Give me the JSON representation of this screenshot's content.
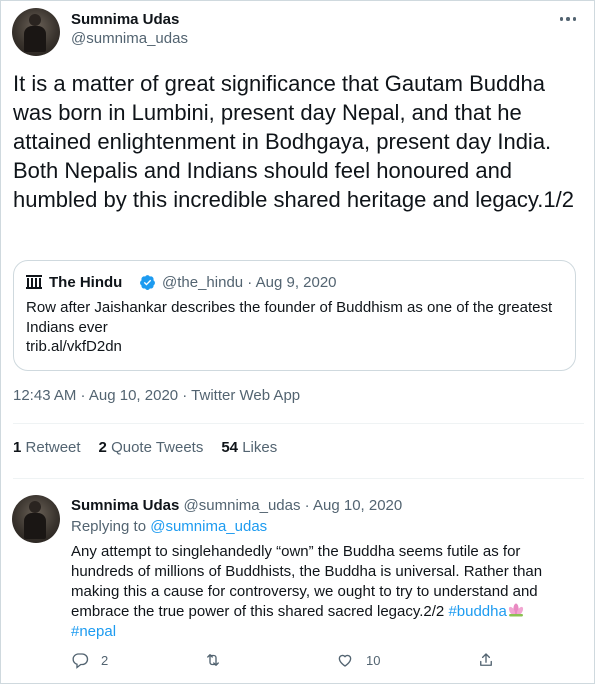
{
  "tweet": {
    "author_name": "Sumnima Udas",
    "author_handle": "@sumnima_udas",
    "text": "It is a matter of great significance that Gautam Buddha was born in Lumbini, present day Nepal, and that he attained enlightenment in Bodhgaya, present day India. Both Nepalis and Indians should feel honoured and humbled by this incredible shared heritage and legacy.1/2",
    "timestamp": "12:43 AM · Aug 10, 2020 · Twitter Web App",
    "icons": {
      "more": "more-icon"
    }
  },
  "quote": {
    "name": "The Hindu",
    "handle_date": "@the_hindu · Aug 9, 2020",
    "text": "Row after Jaishankar describes the founder of Buddhism as one of the greatest Indians ever",
    "link": "trib.al/vkfD2dn",
    "icons": {
      "logo": "the-hindu-icon",
      "verified": "verified-icon"
    }
  },
  "stats": {
    "retweets_count": "1",
    "retweets_label": "Retweet",
    "quotes_count": "2",
    "quotes_label": "Quote Tweets",
    "likes_count": "54",
    "likes_label": "Likes"
  },
  "reply": {
    "author_name": "Sumnima Udas",
    "meta": "@sumnima_udas · Aug 10, 2020",
    "replying_prefix": "Replying to",
    "replying_mention": "@sumnima_udas",
    "text": "Any attempt to singlehandedly “own” the Buddha seems futile as for hundreds of millions of Buddhists, the Buddha is universal. Rather than making this a cause for controversy, we ought to try to understand and embrace the true power of this shared sacred legacy.2/2",
    "hashtag1": "#buddha",
    "hashtag2": "#nepal",
    "actions": {
      "reply_count": "2",
      "like_count": "10"
    }
  },
  "colors": {
    "accent": "#1d9bf0",
    "text": "#0f1419",
    "muted": "#536471",
    "border": "#cfd9de"
  }
}
